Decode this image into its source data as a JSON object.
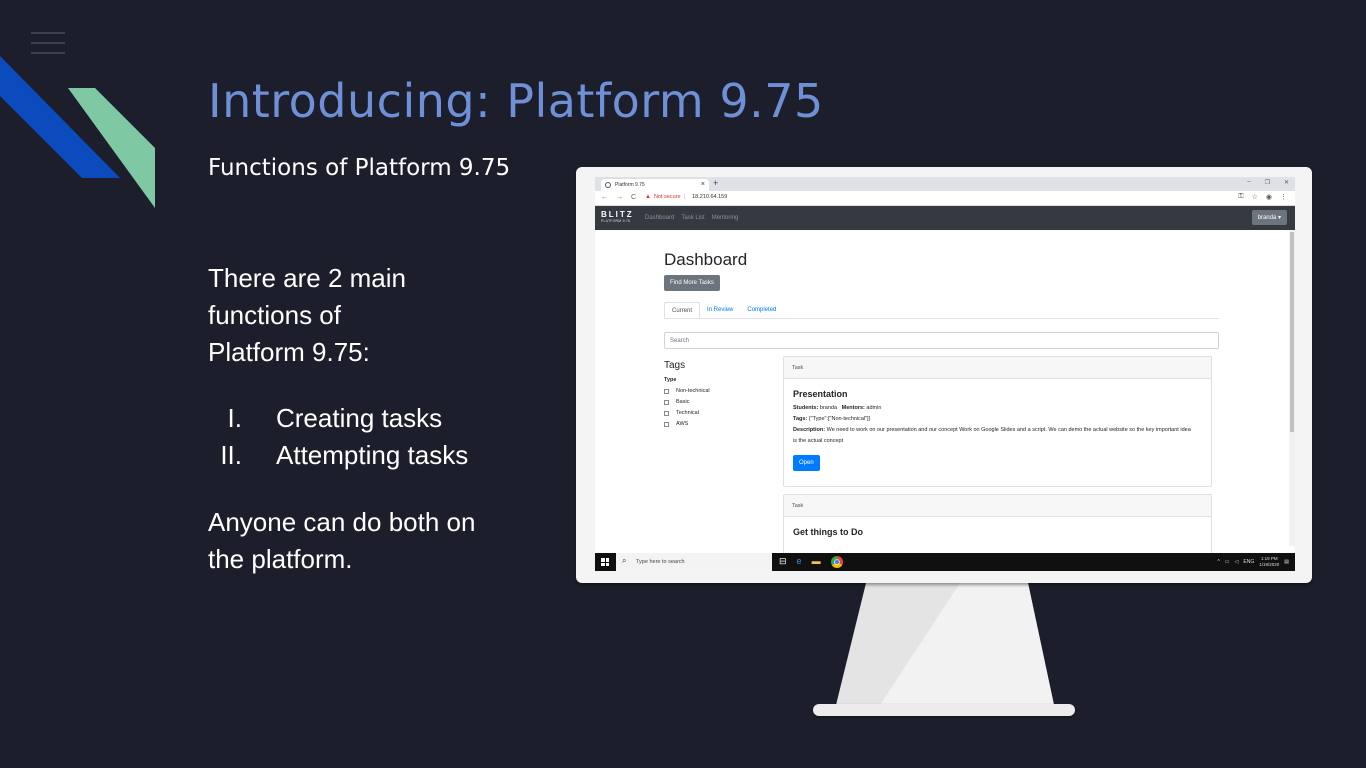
{
  "slide": {
    "title": "Introducing: Platform 9.75",
    "subtitle": "Functions of Platform 9.75",
    "intro": "There are 2 main functions of Platform 9.75:",
    "functions": [
      {
        "num": "I.",
        "label": "Creating tasks"
      },
      {
        "num": "II.",
        "label": "Attempting tasks"
      }
    ],
    "closing": "Anyone can do both on the platform.",
    "colors": {
      "background": "#1c1f2b",
      "title": "#6f8fd6",
      "accent_blue": "#0b4bbd",
      "accent_green": "#7ec8a4"
    }
  },
  "browser": {
    "tab_title": "Platform 9.75",
    "tab_close": "×",
    "new_tab": "+",
    "window_controls": [
      "–",
      "❐",
      "✕"
    ],
    "nav": [
      "←",
      "→",
      "C"
    ],
    "security": "Not secure",
    "url": "18.210.64.159",
    "addr_icons": [
      "⚿",
      "☆",
      "◉",
      "⋮"
    ]
  },
  "site": {
    "brand": "BLITZ",
    "brand_sub": "PLATFORM 9.75",
    "nav": [
      "Dashboard",
      "Task List",
      "Mentoring"
    ],
    "user": "branda ▾",
    "page_title": "Dashboard",
    "find_more": "Find More Tasks",
    "tabs": [
      "Current",
      "In Review",
      "Completed"
    ],
    "search_placeholder": "Search",
    "tags_heading": "Tags",
    "type_heading": "Type",
    "tags": [
      "Non-technical",
      "Basic",
      "Technical",
      "AWS"
    ],
    "cards": [
      {
        "header": "Task",
        "title": "Presentation",
        "students_label": "Students:",
        "students": "branda",
        "mentors_label": "Mentors:",
        "mentors": "admin",
        "tags_label": "Tags:",
        "tags": "{\"Type\":[\"Non-technical\"]}",
        "desc_label": "Description:",
        "description": "We need to work on our presentation and our concept Work on Google Slides and a script. We can demo the actual website so the key important idea is the actual concept",
        "button": "Open"
      },
      {
        "header": "Task",
        "title": "Get things to Do"
      }
    ]
  },
  "taskbar": {
    "search_placeholder": "Type here to search",
    "tray": [
      "^",
      "ENG"
    ],
    "time": "1:19 PM",
    "date": "1/19/2020"
  }
}
